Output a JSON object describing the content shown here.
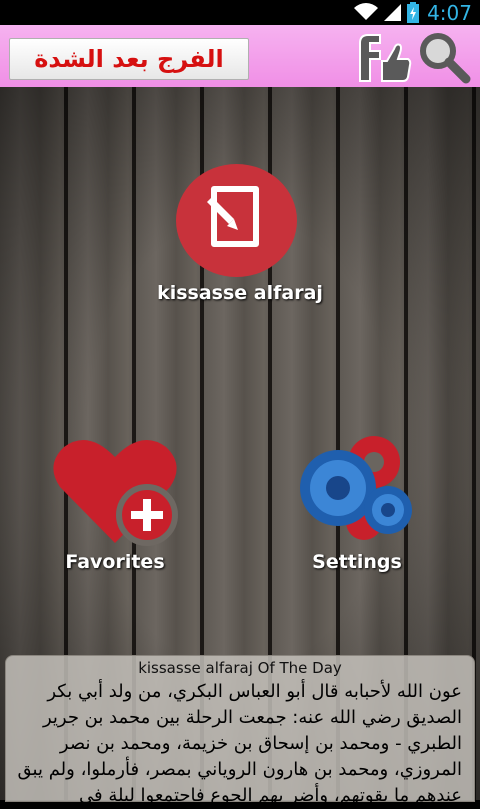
{
  "status_bar": {
    "time": "4:07",
    "icons": [
      "wifi-icon",
      "signal-icon",
      "battery-charging-icon"
    ]
  },
  "header": {
    "title": "الفرج بعد الشدة",
    "facebook_like_icon": "facebook-like-icon",
    "search_icon": "search-icon"
  },
  "tiles": {
    "main": {
      "label": "kissasse alfaraj",
      "icon": "edit-note-icon"
    },
    "favorites": {
      "label": "Favorites",
      "icon": "heart-plus-icon"
    },
    "settings": {
      "label": "Settings",
      "icon": "gears-icon"
    }
  },
  "story_of_day": {
    "title": "kissasse alfaraj Of The Day",
    "text": "عون الله لأحبابه قال أبو العباس البكري، من ولد أبي بكر الصديق رضي الله عنه: جمعت الرحلة بين محمد بن جرير الطبري - ومحمد بن إسحاق بن خزيمة، ومحمد بن نصر المروزي، ومحمد بن هارون الروياني بمصر، فأرملوا، ولم يبق عندهم ما يقوتهم، وأضر بهم الجوع فاجتمعوا ليلة في"
  },
  "colors": {
    "header_pink": "#f08fe6",
    "title_red": "#d61010",
    "circle_red": "#c8323b",
    "clock_blue": "#33b5e5"
  }
}
